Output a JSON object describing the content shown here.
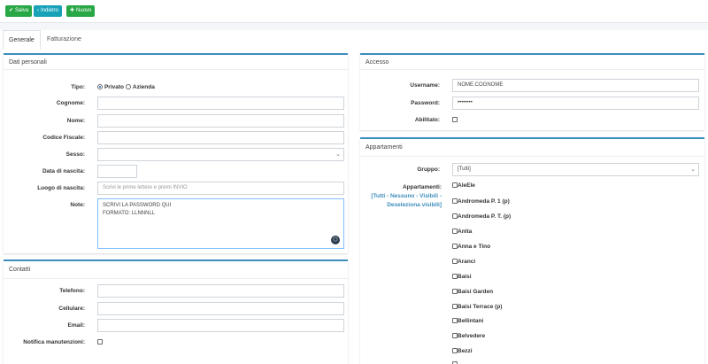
{
  "toolbar": {
    "save": "Salva",
    "back": "Indietro",
    "new": "Nuovo"
  },
  "tabs": {
    "general": "Generale",
    "billing": "Fatturazione"
  },
  "personal": {
    "title": "Dati personali",
    "type_label": "Tipo:",
    "type_private": "Privato",
    "type_company": "Azienda",
    "surname_label": "Cognome:",
    "name_label": "Nome:",
    "tax_code_label": "Codice Fiscale:",
    "sex_label": "Sesso:",
    "birth_date_label": "Data di nascita:",
    "birth_place_label": "Luogo di nascita:",
    "birth_place_placeholder": "Scrivi le prime lettere e premi INVIO",
    "notes_label": "Note:",
    "notes_line1": "SCRIVI LA PASSWORD QUI",
    "notes_line2": "FORMATO: LLNNNLL"
  },
  "contacts": {
    "title": "Contatti",
    "phone_label": "Telefono:",
    "mobile_label": "Cellulare:",
    "email_label": "Email:",
    "maintenance_label": "Notifica manutenzioni:"
  },
  "access": {
    "title": "Accesso",
    "username_label": "Username:",
    "username_value": "NOME.COGNOME",
    "password_label": "Password:",
    "password_value": "••••••••",
    "enabled_label": "Abilitato:"
  },
  "apartments": {
    "title": "Appartamenti",
    "group_label": "Gruppo:",
    "group_value": "[Tutti]",
    "list_label": "Appartamenti:",
    "link_all": "Tutti",
    "link_none": "Nessuno",
    "link_visible": "Visibili",
    "link_deselect": "Deseleziona visibili",
    "items": [
      "AleEle",
      "Andromeda P. 1 (p)",
      "Andromeda P. T. (p)",
      "Anita",
      "Anna e Tino",
      "Aranci",
      "Baisi",
      "Baisi Garden",
      "Baisi Terrace (p)",
      "Bellintani",
      "Belvedere",
      "Bezzi"
    ]
  }
}
